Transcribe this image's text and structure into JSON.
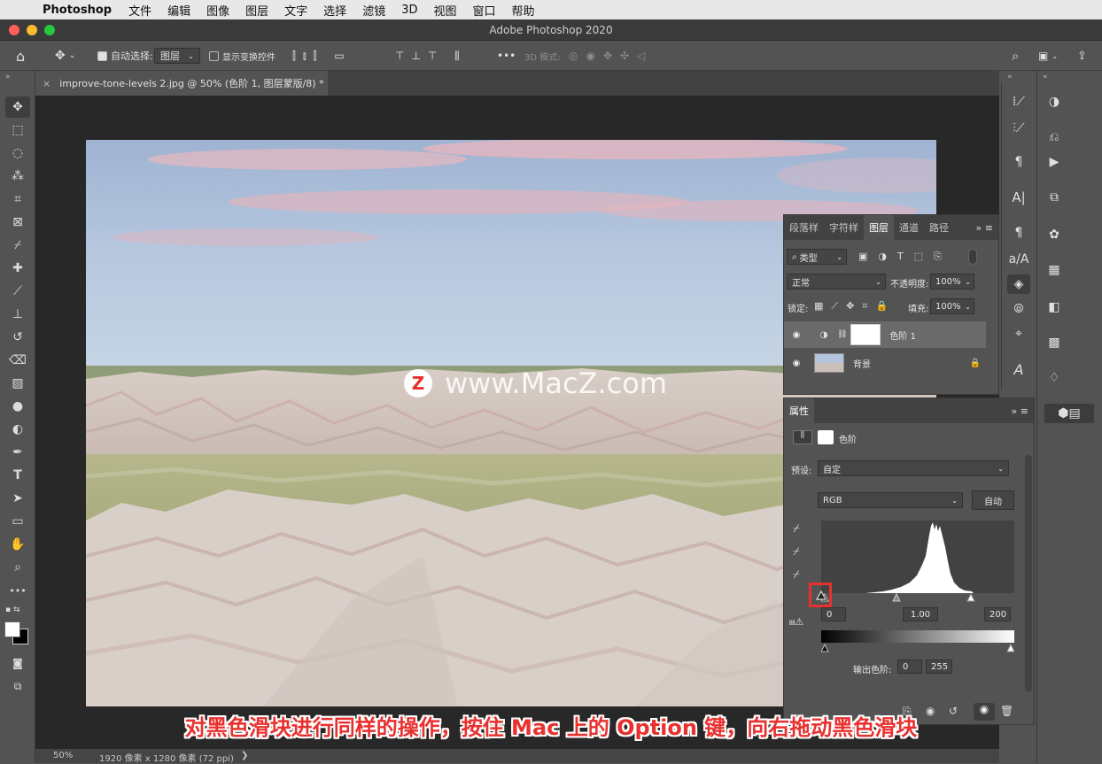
{
  "menubar": {
    "app": "Photoshop",
    "items": [
      "文件",
      "编辑",
      "图像",
      "图层",
      "文字",
      "选择",
      "滤镜",
      "3D",
      "视图",
      "窗口",
      "帮助"
    ]
  },
  "window": {
    "title": "Adobe Photoshop 2020"
  },
  "options": {
    "auto_select_label": "自动选择:",
    "auto_select_value": "图层",
    "show_transform_label": "显示变换控件",
    "mode3d_label": "3D 模式:",
    "more": "•••"
  },
  "doc": {
    "tab_label": "improve-tone-levels 2.jpg @ 50% (色阶 1, 图层蒙版/8) *",
    "tab_close": "×",
    "zoom": "50%",
    "info": "1920 像素 x 1280 像素 (72 ppi)",
    "info_arrow": "❯"
  },
  "watermark": {
    "letter": "Z",
    "text": "www.MacZ.com"
  },
  "layers_panel": {
    "tabs": [
      "段落样",
      "字符样",
      "图层",
      "通道",
      "路径"
    ],
    "filter_label": "类型",
    "blend_mode": "正常",
    "opacity_label": "不透明度:",
    "opacity_value": "100%",
    "lock_label": "锁定:",
    "fill_label": "填充:",
    "fill_value": "100%",
    "layers": [
      {
        "name": "色阶 1"
      },
      {
        "name": "背景"
      }
    ]
  },
  "properties": {
    "tab": "属性",
    "adjustment": "色阶",
    "preset_label": "预设:",
    "preset_value": "自定",
    "channel": "RGB",
    "auto_button": "自动",
    "input_black": "0",
    "input_gamma": "1.00",
    "input_white": "200",
    "output_label": "输出色阶:",
    "output_black": "0",
    "output_white": "255"
  },
  "caption": "对黑色滑块进行同样的操作，按住 Mac 上的 Option 键，向右拖动黑色滑块",
  "colors": {
    "highlight_box": "#e8312f",
    "panel_bg": "#535353",
    "canvas_bg": "#282828"
  }
}
